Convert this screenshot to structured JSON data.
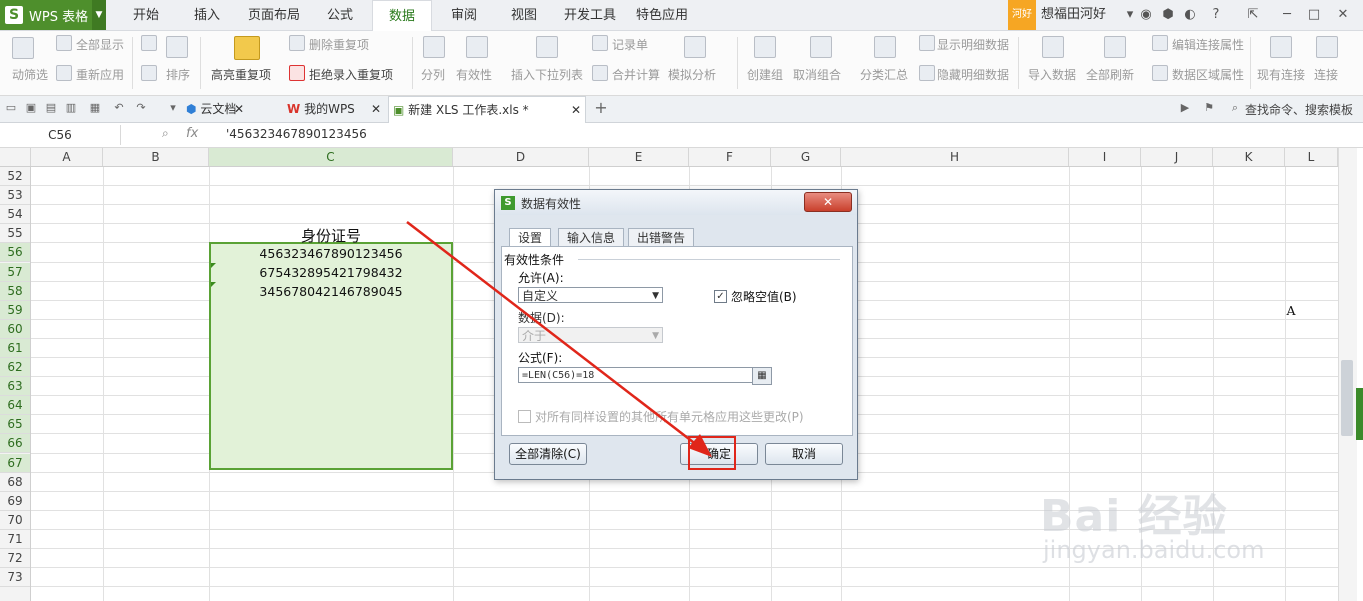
{
  "app": {
    "logo": "S",
    "name": "WPS 表格"
  },
  "menu_tabs": [
    "开始",
    "插入",
    "页面布局",
    "公式",
    "数据",
    "审阅",
    "视图",
    "开发工具",
    "特色应用"
  ],
  "active_menu": "数据",
  "user": {
    "badge": "河好",
    "name": "想福田河好"
  },
  "ribbon": {
    "filter_auto": "动筛选",
    "show_all": "全部显示",
    "reapply": "重新应用",
    "sort": "排序",
    "highlight_dup": "高亮重复项",
    "remove_dup": "删除重复项",
    "reject_dup": "拒绝录入重复项",
    "split": "分列",
    "validity": "有效性",
    "insert_dropdown": "插入下拉列表",
    "record": "记录单",
    "merge_calc": "合并计算",
    "simulate": "模拟分析",
    "group": "创建组",
    "ungroup": "取消组合",
    "subtotal": "分类汇总",
    "show_detail": "显示明细数据",
    "hide_detail": "隐藏明细数据",
    "import": "导入数据",
    "refresh_all": "全部刷新",
    "edit_link": "编辑连接属性",
    "data_region": "数据区域属性",
    "existing_conn": "现有连接",
    "connect": "连接"
  },
  "doc_tabs": [
    {
      "label": "云文档"
    },
    {
      "label": "我的WPS"
    },
    {
      "label": "新建 XLS 工作表.xls *"
    }
  ],
  "search_cmd": "查找命令、搜索模板",
  "formula_bar": {
    "name_box": "C56",
    "fx": "fx",
    "formula": "'456323467890123456"
  },
  "columns": [
    "A",
    "B",
    "C",
    "D",
    "E",
    "F",
    "G",
    "H",
    "I",
    "J",
    "K",
    "L"
  ],
  "selected_column": "C",
  "rows": [
    "52",
    "53",
    "54",
    "55",
    "56",
    "57",
    "58",
    "59",
    "60",
    "61",
    "62",
    "63",
    "64",
    "65",
    "66",
    "67",
    "68",
    "69",
    "70",
    "71",
    "72",
    "73"
  ],
  "cells": {
    "header": "身份证号",
    "c56": "456323467890123456",
    "c57": "675432895421798432",
    "c58": "345678042146789045",
    "l59": "A"
  },
  "dialog": {
    "logo": "S",
    "title": "数据有效性",
    "close": "✕",
    "tabs": [
      "设置",
      "输入信息",
      "出错警告"
    ],
    "section": "有效性条件",
    "allow_label": "允许(A):",
    "allow_value": "自定义",
    "ignore_blank": "忽略空值(B)",
    "ignore_blank_checked": "✓",
    "data_label": "数据(D):",
    "data_value": "介于",
    "formula_label": "公式(F):",
    "formula_value": "=LEN(C56)=18",
    "apply_all": "对所有同样设置的其他所有单元格应用这些更改(P)",
    "clear_all": "全部清除(C)",
    "ok": "确定",
    "cancel": "取消"
  },
  "watermark": {
    "brand": "Bai 经验",
    "url": "jingyan.baidu.com"
  },
  "colors": {
    "accent": "#4e8f2c",
    "selection_fill": "#e2f2d8",
    "annotation_red": "#e0261a"
  }
}
